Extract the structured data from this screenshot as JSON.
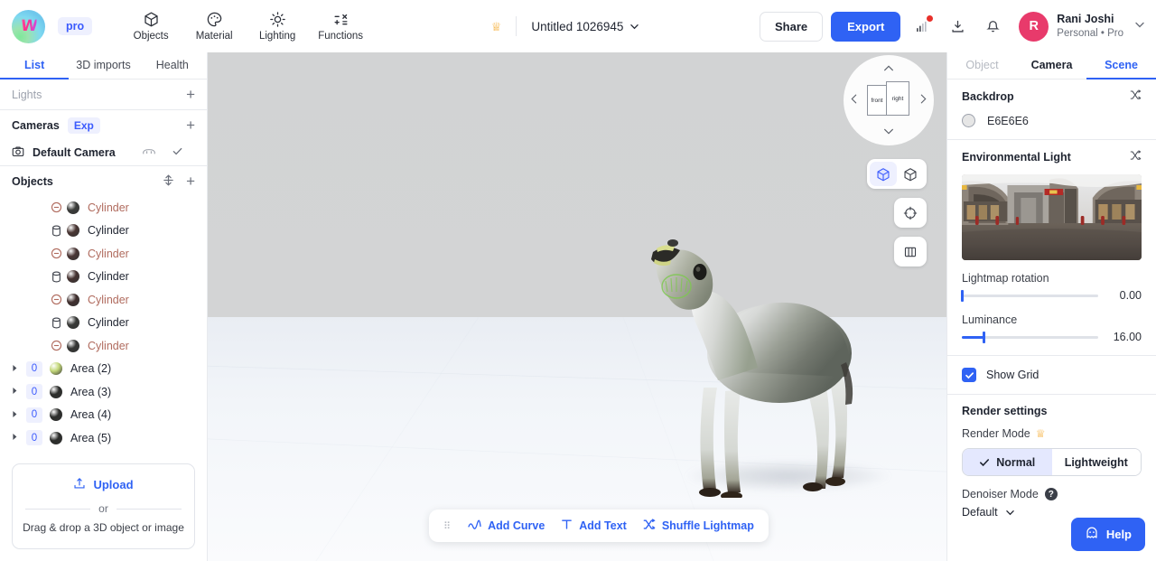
{
  "header": {
    "logo_glyph": "W",
    "pro_badge": "pro",
    "nav_tools": [
      {
        "label": "Objects",
        "icon": "cube-icon"
      },
      {
        "label": "Material",
        "icon": "palette-icon"
      },
      {
        "label": "Lighting",
        "icon": "sun-icon"
      },
      {
        "label": "Functions",
        "icon": "functions-icon"
      }
    ],
    "crown_icon": "crown-icon",
    "document_title": "Untitled 1026945",
    "share_label": "Share",
    "export_label": "Export",
    "icons": [
      "analytics-icon",
      "download-icon",
      "bell-icon"
    ],
    "avatar_initial": "R",
    "user_name": "Rani Joshi",
    "user_plan": "Personal • Pro"
  },
  "left_panel": {
    "tabs": [
      {
        "label": "List",
        "active": true
      },
      {
        "label": "3D imports",
        "active": false
      },
      {
        "label": "Health",
        "active": false
      }
    ],
    "lights": {
      "title": "Lights",
      "add": "+"
    },
    "cameras": {
      "title": "Cameras",
      "badge": "Exp",
      "add": "+",
      "items": [
        {
          "label": "Default Camera",
          "icon": "camera-icon"
        }
      ]
    },
    "objects": {
      "title": "Objects",
      "add": "+",
      "sort_icon": "sort-icon",
      "items": [
        {
          "label": "Cylinder",
          "icon": "hidden-icon",
          "color": "#3c3d3b",
          "dim": true,
          "num": null
        },
        {
          "label": "Cylinder",
          "icon": "cylinder-icon",
          "color": "#4a3633",
          "dim": false,
          "num": null
        },
        {
          "label": "Cylinder",
          "icon": "hidden-icon",
          "color": "#4a3635",
          "dim": true,
          "num": null
        },
        {
          "label": "Cylinder",
          "icon": "cylinder-icon",
          "color": "#463331",
          "dim": false,
          "num": null
        },
        {
          "label": "Cylinder",
          "icon": "hidden-icon",
          "color": "#41302f",
          "dim": true,
          "num": null
        },
        {
          "label": "Cylinder",
          "icon": "cylinder-icon",
          "color": "#3a3b39",
          "dim": false,
          "num": null
        },
        {
          "label": "Cylinder",
          "icon": "hidden-icon",
          "color": "#363735",
          "dim": true,
          "num": null
        },
        {
          "label": "Area (2)",
          "icon": "expand-icon",
          "color": "#c3d87a",
          "dim": false,
          "num": "0"
        },
        {
          "label": "Area (3)",
          "icon": "expand-icon",
          "color": "#2b2c2a",
          "dim": false,
          "num": "0"
        },
        {
          "label": "Area (4)",
          "icon": "expand-icon",
          "color": "#2b2c2a",
          "dim": false,
          "num": "0"
        },
        {
          "label": "Area (5)",
          "icon": "expand-icon",
          "color": "#2b2c2a",
          "dim": false,
          "num": "0"
        }
      ]
    },
    "upload": {
      "link_label": "Upload",
      "or_label": "or",
      "drag_text": "Drag & drop a 3D object or image"
    }
  },
  "viewport": {
    "gizmo": {
      "cube_front": "front",
      "cube_right": "right",
      "arrow_up": "▲",
      "arrow_down": "▼",
      "arrow_left": "◀",
      "arrow_right": "▶"
    },
    "tools": [
      {
        "icon": "solid-cube-icon",
        "active": true
      },
      {
        "icon": "wireframe-cube-icon",
        "active": false
      },
      {
        "icon": "target-icon",
        "active": false
      },
      {
        "icon": "columns-icon",
        "active": false
      }
    ],
    "bottom_toolbar": {
      "drag_handle": "⠿",
      "items": [
        {
          "label": "Add Curve",
          "icon": "curve-icon"
        },
        {
          "label": "Add Text",
          "icon": "text-icon"
        },
        {
          "label": "Shuffle Lightmap",
          "icon": "shuffle-icon"
        }
      ]
    }
  },
  "right_panel": {
    "tabs": [
      {
        "label": "Object",
        "state": "disabled"
      },
      {
        "label": "Camera",
        "state": "normal"
      },
      {
        "label": "Scene",
        "state": "active"
      }
    ],
    "backdrop": {
      "title": "Backdrop",
      "shuffle_icon": "shuffle-icon",
      "color_value": "E6E6E6",
      "color_hex": "#E6E6E6"
    },
    "environmental_light": {
      "title": "Environmental Light",
      "shuffle_icon": "shuffle-icon",
      "thumbnail_alt": "360 panorama of a shopping arcade",
      "lightmap_rotation": {
        "label": "Lightmap rotation",
        "value": "0.00",
        "percent": 0
      },
      "luminance": {
        "label": "Luminance",
        "value": "16.00",
        "percent": 16
      }
    },
    "show_grid": {
      "label": "Show Grid",
      "checked": true
    },
    "render_settings": {
      "title": "Render settings",
      "render_mode": {
        "label": "Render Mode",
        "crown_icon": "crown-icon",
        "options": [
          {
            "label": "Normal",
            "active": true
          },
          {
            "label": "Lightweight",
            "active": false
          }
        ]
      },
      "denoiser_mode": {
        "label": "Denoiser Mode",
        "help_icon": "question-icon",
        "value": "Default"
      }
    }
  },
  "help": {
    "label": "Help",
    "icon": "ghost-icon"
  },
  "colors": {
    "accent": "#2f62f4",
    "accent_soft": "#eef0fe",
    "avatar": "#e83a6b",
    "crown": "#f5a623",
    "notification": "#e8302a",
    "backdrop": "#E6E6E6"
  }
}
